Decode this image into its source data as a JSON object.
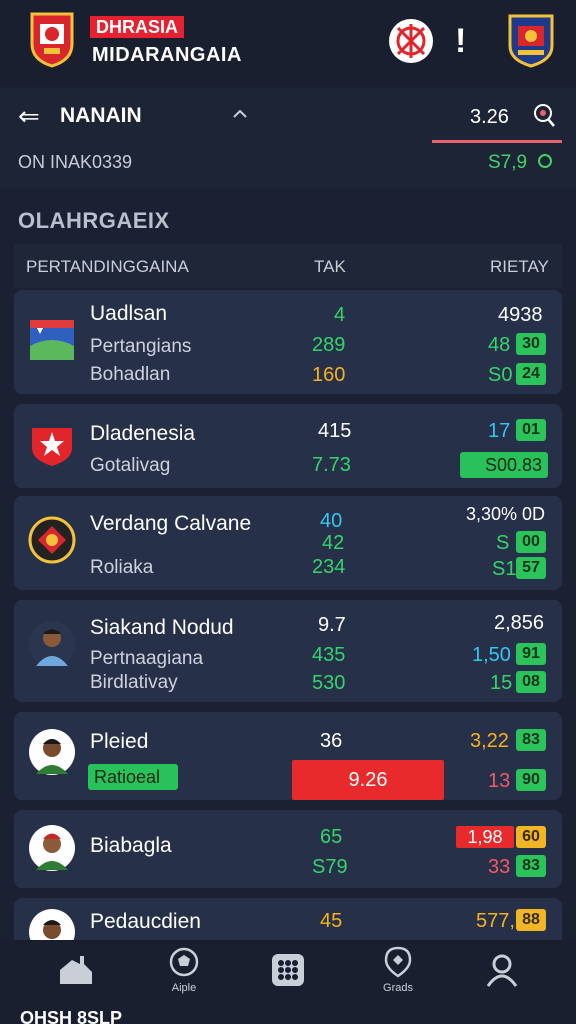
{
  "header": {
    "brand_line1": "DHRASIA",
    "brand_line2": "MIDARANGAIA",
    "alert_glyph": "!",
    "icons": [
      "shield-logo",
      "soccer-ball-icon",
      "alert-icon",
      "badge-logo"
    ]
  },
  "subheader": {
    "back_glyph": "⇐",
    "title": "NANAIN",
    "value": "3.26",
    "left_text": "ON  INAK0339",
    "right_text": "S7,9"
  },
  "section": {
    "title": "OLAHRGAEIX",
    "columns": [
      "PERTANDINGGAINA",
      "TAK",
      "RIETAY"
    ]
  },
  "rows": [
    {
      "name": "Uadlsan",
      "sub1": "Pertangians",
      "sub2": "Bohadlan",
      "mid": [
        "4",
        "289",
        "160"
      ],
      "right_top": "4938",
      "right_vals": [
        "48",
        "S0"
      ],
      "badges": [
        "30",
        "24"
      ]
    },
    {
      "name": "Dladenesia",
      "sub1": "Gotalivag",
      "mid": [
        "415",
        "7.73"
      ],
      "right_top": "17",
      "right_badge": "01",
      "right_box": "S00.83"
    },
    {
      "name": "Verdang Calvane",
      "sub1": "Roliaka",
      "mid": [
        "40",
        "42",
        "234"
      ],
      "right_top": "3,30% 0D",
      "right_vals": [
        "S",
        "S1"
      ],
      "badges": [
        "00",
        "57"
      ]
    },
    {
      "name": "Siakand Nodud",
      "sub1": "Pertnaagiana",
      "sub2": "Birdlativay",
      "mid": [
        "9.7",
        "435",
        "530"
      ],
      "right_top": "2,856",
      "right_vals": [
        "1,50",
        "15"
      ],
      "badges": [
        "91",
        "08"
      ]
    },
    {
      "name": "Pleied",
      "tag": "Ratioeal",
      "mid": [
        "36"
      ],
      "red_value": "9.26",
      "right_vals": [
        "3,22",
        "13"
      ],
      "badges": [
        "83",
        "90"
      ]
    },
    {
      "name": "Biabagla",
      "mid": [
        "65",
        "S79"
      ],
      "right_red": "1,98",
      "right_vals": [
        "33"
      ],
      "badges": [
        "60",
        "83"
      ]
    },
    {
      "name": "Pedaucdien",
      "mid": [
        "45"
      ],
      "right_top": "577,",
      "badges": [
        "88"
      ]
    }
  ],
  "bottom_nav": {
    "items": [
      {
        "icon": "stadium-icon",
        "label": ""
      },
      {
        "icon": "soccer-ball-icon",
        "label": "Aiple"
      },
      {
        "icon": "grid-icon",
        "label": ""
      },
      {
        "icon": "location-pin-icon",
        "label": "Grads"
      },
      {
        "icon": "profile-icon",
        "label": ""
      }
    ]
  },
  "footer": {
    "text": "OHSH 8SLP"
  },
  "colors": {
    "background": "#1b2133",
    "card": "#263049",
    "green": "#35d46b",
    "yellow": "#f6b21c",
    "red": "#e82a2c",
    "cyan": "#36c6f0"
  }
}
